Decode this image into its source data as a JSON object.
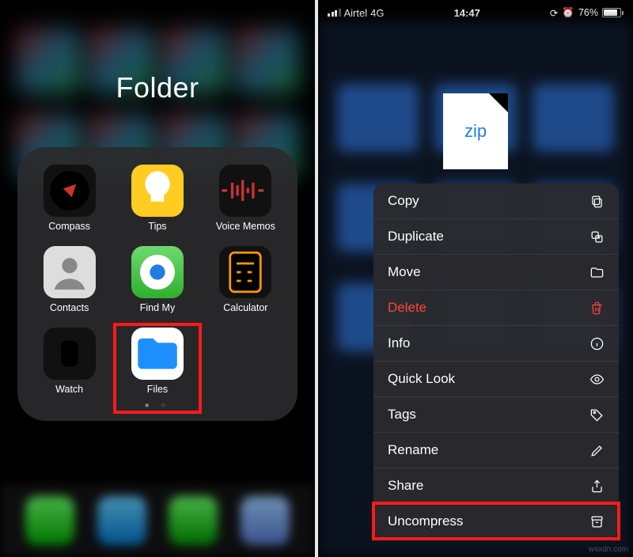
{
  "left": {
    "folder_title": "Folder",
    "apps": [
      {
        "name": "Compass",
        "iconCls": "ic-compass",
        "icon": "compass"
      },
      {
        "name": "Tips",
        "iconCls": "ic-tips",
        "icon": "tips"
      },
      {
        "name": "Voice Memos",
        "iconCls": "ic-voice",
        "icon": "voice"
      },
      {
        "name": "Contacts",
        "iconCls": "ic-contacts",
        "icon": "contacts"
      },
      {
        "name": "Find My",
        "iconCls": "ic-findmy",
        "icon": "findmy"
      },
      {
        "name": "Calculator",
        "iconCls": "ic-calc",
        "icon": "calc"
      },
      {
        "name": "Watch",
        "iconCls": "ic-watch",
        "icon": "watch"
      },
      {
        "name": "Files",
        "iconCls": "ic-files",
        "icon": "files"
      }
    ],
    "highlight_app_index": 7,
    "page_dots": "● ○"
  },
  "right": {
    "status": {
      "carrier": "Airtel",
      "network": "4G",
      "time": "14:47",
      "alarm": true,
      "battery_pct": "76%"
    },
    "zip_label": "zip",
    "context_menu": [
      {
        "label": "Copy",
        "icon": "copy",
        "danger": false
      },
      {
        "label": "Duplicate",
        "icon": "duplicate",
        "danger": false
      },
      {
        "label": "Move",
        "icon": "folder",
        "danger": false
      },
      {
        "label": "Delete",
        "icon": "trash",
        "danger": true
      },
      {
        "label": "Info",
        "icon": "info",
        "danger": false
      },
      {
        "label": "Quick Look",
        "icon": "eye",
        "danger": false
      },
      {
        "label": "Tags",
        "icon": "tag",
        "danger": false
      },
      {
        "label": "Rename",
        "icon": "pencil",
        "danger": false
      },
      {
        "label": "Share",
        "icon": "share",
        "danger": false
      },
      {
        "label": "Uncompress",
        "icon": "archive",
        "danger": false
      }
    ],
    "highlight_menu_index": 9
  },
  "watermark": "wsxdn.com"
}
